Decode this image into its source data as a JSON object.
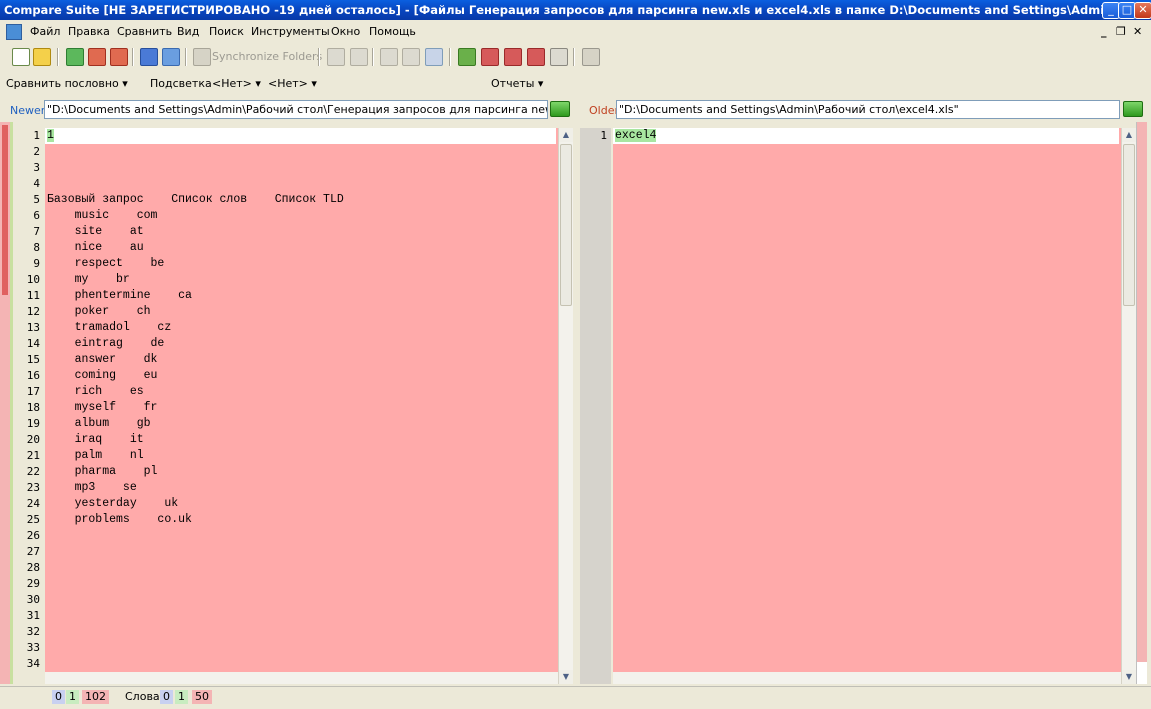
{
  "window": {
    "title": "Compare Suite [НЕ ЗАРЕГИСТРИРОВАНО -19 дней осталось] - [Файлы Генерация запросов для парсинга new.xls и excel4.xls в папке D:\\Documents and Settings\\Admin\\Pa]",
    "minimize": "_",
    "maximize": "□",
    "close": "✕"
  },
  "menu": {
    "items": [
      "Файл",
      "Правка",
      "Сравнить",
      "Вид",
      "Поиск",
      "Инструменты",
      "Окно",
      "Помощь"
    ],
    "mdi_minimize": "_",
    "mdi_restore": "❐",
    "mdi_close": "✕"
  },
  "toolbar": {
    "sync_label": "Synchronize Folders"
  },
  "bar2": {
    "compare_mode": "Сравнить  пословно",
    "highlight_label": "Подсветка",
    "highlight_value1": "<Нет>",
    "highlight_value2": "<Нет>",
    "reports_label": "Отчеты"
  },
  "left": {
    "tag": "Newer",
    "path": "\"D:\\Documents and Settings\\Admin\\Рабочий стол\\Генерация запросов для парсинга new.xls\"",
    "line_numbers": [
      "1",
      "2",
      "3",
      "4",
      "5",
      "6",
      "7",
      "8",
      "9",
      "10",
      "11",
      "12",
      "13",
      "14",
      "15",
      "16",
      "17",
      "18",
      "19",
      "20",
      "21",
      "22",
      "23",
      "24",
      "25",
      "26",
      "27",
      "28",
      "29",
      "30",
      "31",
      "32",
      "33",
      "34"
    ],
    "lines": [
      "1",
      "",
      "",
      "",
      "Базовый запрос    Список слов    Список TLD",
      "    music    com",
      "    site    at",
      "    nice    au",
      "    respect    be",
      "    my    br",
      "    phentermine    ca",
      "    poker    ch",
      "    tramadol    cz",
      "    eintrag    de",
      "    answer    dk",
      "    coming    eu",
      "    rich    es",
      "    myself    fr",
      "    album    gb",
      "    iraq    it",
      "    palm    nl",
      "    pharma    pl",
      "    mp3    se",
      "    yesterday    uk",
      "    problems    co.uk",
      "",
      "",
      "",
      "",
      "",
      "",
      "",
      "",
      ""
    ]
  },
  "right": {
    "tag": "Older",
    "path": "\"D:\\Documents and Settings\\Admin\\Рабочий стол\\excel4.xls\"",
    "line_numbers": [
      "1"
    ],
    "lines": [
      "excel4"
    ]
  },
  "status": {
    "lines_0": "0",
    "lines_1": "1",
    "lines_102": "102",
    "words_label": "Слова",
    "words_0": "0",
    "words_1": "1",
    "words_50": "50"
  }
}
